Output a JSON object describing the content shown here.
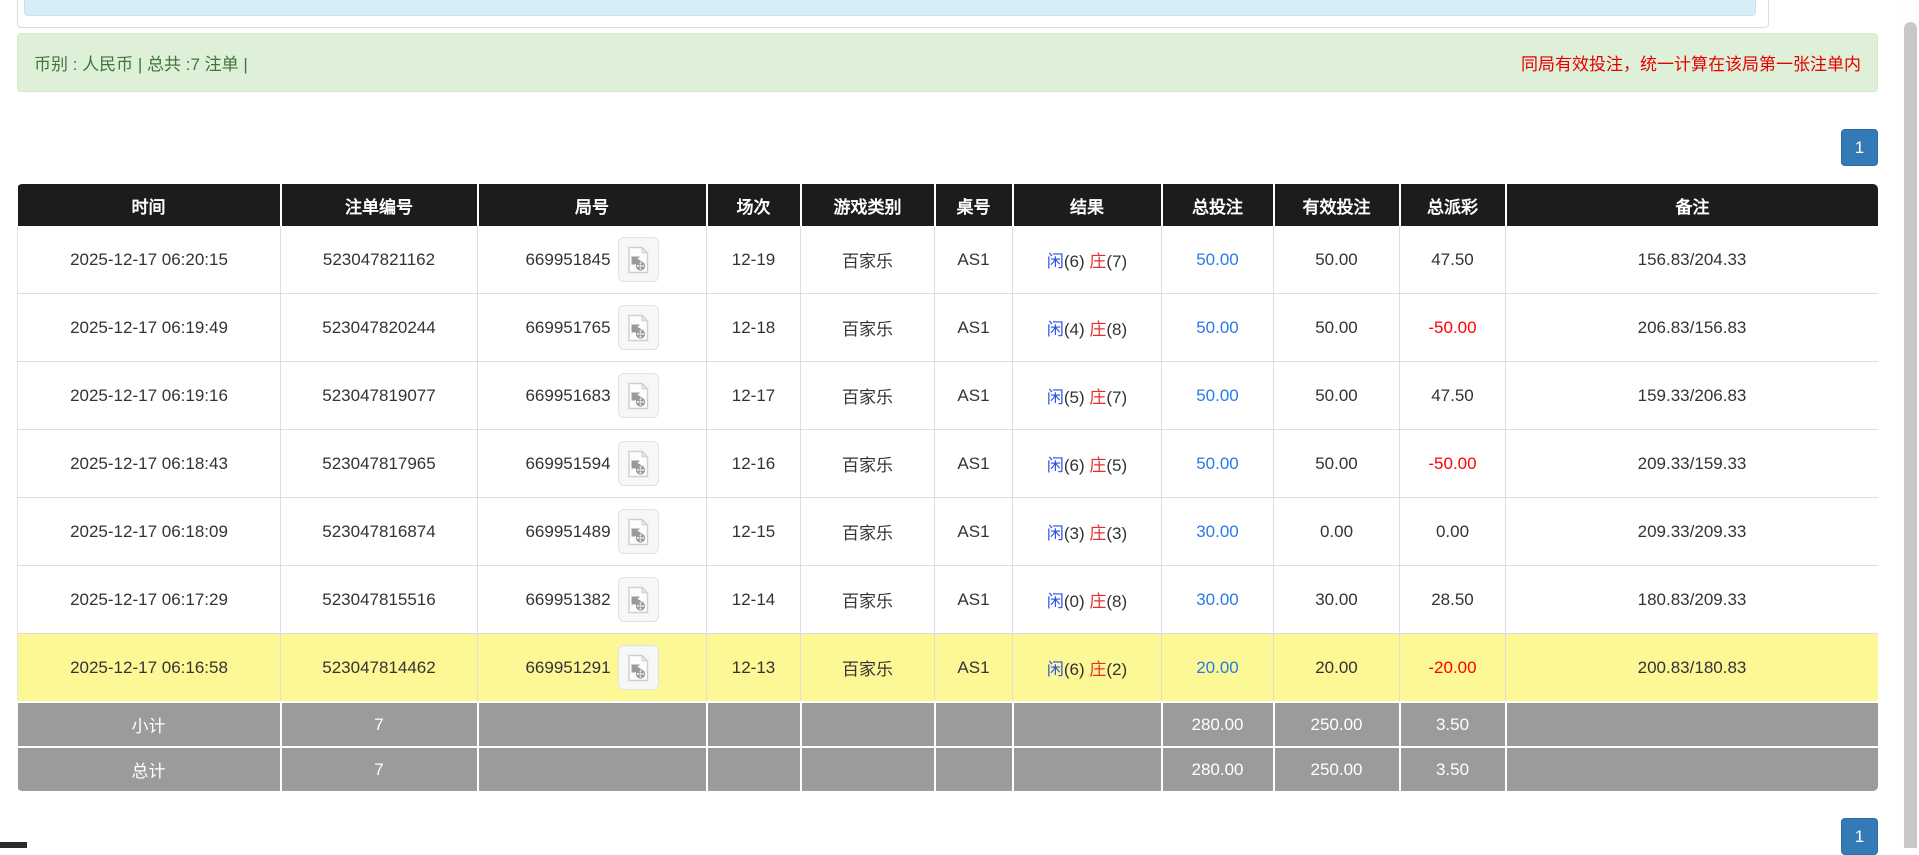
{
  "summary_bar": {
    "left_text": "币别 : 人民币 | 总共 :7 注单 |",
    "right_note": "同局有效投注，统一计算在该局第一张注单内"
  },
  "pagination": {
    "page": "1"
  },
  "table": {
    "headers": [
      "时间",
      "注单编号",
      "局号",
      "场次",
      "游戏类别",
      "桌号",
      "结果",
      "总投注",
      "有效投注",
      "总派彩",
      "备注"
    ],
    "rows": [
      {
        "time": "2025-12-17 06:20:15",
        "bet_id": "523047821162",
        "round_no": "669951845",
        "session": "12-19",
        "game": "百家乐",
        "table_no": "AS1",
        "result": {
          "p_label": "闲",
          "p_score": "(6)",
          "b_label": "庄",
          "b_score": "(7)"
        },
        "total_bet": "50.00",
        "valid_bet": "50.00",
        "payout": "47.50",
        "remark": "156.83/204.33",
        "highlight": false
      },
      {
        "time": "2025-12-17 06:19:49",
        "bet_id": "523047820244",
        "round_no": "669951765",
        "session": "12-18",
        "game": "百家乐",
        "table_no": "AS1",
        "result": {
          "p_label": "闲",
          "p_score": "(4)",
          "b_label": "庄",
          "b_score": "(8)"
        },
        "total_bet": "50.00",
        "valid_bet": "50.00",
        "payout": "-50.00",
        "remark": "206.83/156.83",
        "highlight": false
      },
      {
        "time": "2025-12-17 06:19:16",
        "bet_id": "523047819077",
        "round_no": "669951683",
        "session": "12-17",
        "game": "百家乐",
        "table_no": "AS1",
        "result": {
          "p_label": "闲",
          "p_score": "(5)",
          "b_label": "庄",
          "b_score": "(7)"
        },
        "total_bet": "50.00",
        "valid_bet": "50.00",
        "payout": "47.50",
        "remark": "159.33/206.83",
        "highlight": false
      },
      {
        "time": "2025-12-17 06:18:43",
        "bet_id": "523047817965",
        "round_no": "669951594",
        "session": "12-16",
        "game": "百家乐",
        "table_no": "AS1",
        "result": {
          "p_label": "闲",
          "p_score": "(6)",
          "b_label": "庄",
          "b_score": "(5)"
        },
        "total_bet": "50.00",
        "valid_bet": "50.00",
        "payout": "-50.00",
        "remark": "209.33/159.33",
        "highlight": false
      },
      {
        "time": "2025-12-17 06:18:09",
        "bet_id": "523047816874",
        "round_no": "669951489",
        "session": "12-15",
        "game": "百家乐",
        "table_no": "AS1",
        "result": {
          "p_label": "闲",
          "p_score": "(3)",
          "b_label": "庄",
          "b_score": "(3)"
        },
        "total_bet": "30.00",
        "valid_bet": "0.00",
        "payout": "0.00",
        "remark": "209.33/209.33",
        "highlight": false
      },
      {
        "time": "2025-12-17 06:17:29",
        "bet_id": "523047815516",
        "round_no": "669951382",
        "session": "12-14",
        "game": "百家乐",
        "table_no": "AS1",
        "result": {
          "p_label": "闲",
          "p_score": "(0)",
          "b_label": "庄",
          "b_score": "(8)"
        },
        "total_bet": "30.00",
        "valid_bet": "30.00",
        "payout": "28.50",
        "remark": "180.83/209.33",
        "highlight": false
      },
      {
        "time": "2025-12-17 06:16:58",
        "bet_id": "523047814462",
        "round_no": "669951291",
        "session": "12-13",
        "game": "百家乐",
        "table_no": "AS1",
        "result": {
          "p_label": "闲",
          "p_score": "(6)",
          "b_label": "庄",
          "b_score": "(2)"
        },
        "total_bet": "20.00",
        "valid_bet": "20.00",
        "payout": "-20.00",
        "remark": "200.83/180.83",
        "highlight": true
      }
    ],
    "subtotal": {
      "label": "小计",
      "count": "7",
      "total_bet": "280.00",
      "valid_bet": "250.00",
      "payout": "3.50"
    },
    "total": {
      "label": "总计",
      "count": "7",
      "total_bet": "280.00",
      "valid_bet": "250.00",
      "payout": "3.50"
    }
  },
  "icons": {
    "round_replay": "video-file-icon"
  },
  "colors": {
    "header_bg": "#1c1c1c",
    "summary_bg": "#dff0d8",
    "summary_text": "#3c763d",
    "note_red": "#e60000",
    "highlight_yellow": "#fcf896",
    "subtotal_gray": "#9b9b9b",
    "link_blue": "#2979e8",
    "xian_blue": "#2b50e5",
    "zhuang_red": "#e62e2e",
    "negative_red": "#ff0000",
    "pagination_blue": "#337ab7",
    "info_strip_blue": "#d9edf7"
  }
}
